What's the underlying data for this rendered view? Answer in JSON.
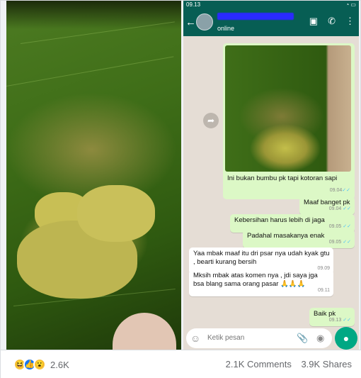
{
  "status_bar": {
    "time": "09.13",
    "right": "◔ ▭"
  },
  "chat_header": {
    "status": "online"
  },
  "image_message": {
    "caption": "Ini bukan bumbu pk tapi kotoran sapi",
    "time": "09.04"
  },
  "messages": [
    {
      "text": "Maaf banget pk",
      "time": "09.04",
      "dir": "out"
    },
    {
      "text": "Kebersihan harus lebih di jaga",
      "time": "09.05",
      "dir": "out"
    },
    {
      "text": "Padahal masakanya enak",
      "time": "09.05",
      "dir": "out"
    },
    {
      "text": "Yaa mbak maaf itu dri psar nya udah kyak gtu , bearti kurang bersih",
      "time": "09.09",
      "dir": "in"
    },
    {
      "text": "Mksih mbak atas komen nya , jdi saya jga bsa blang sama orang pasar 🙏🙏🙏",
      "time": "09.11",
      "dir": "in"
    },
    {
      "text": "Baik pk",
      "time": "09.13",
      "dir": "out"
    }
  ],
  "input": {
    "placeholder": "Ketik pesan"
  },
  "icons": {
    "back": "arrow-left-icon",
    "video": "video-call-icon",
    "phone": "phone-icon",
    "menu": "more-vertical-icon",
    "emoji": "emoji-icon",
    "attach": "paperclip-icon",
    "camera": "camera-icon",
    "mic": "mic-icon",
    "share": "forward-icon"
  },
  "colors": {
    "header": "#075e54",
    "outgoing": "#dcf8c6",
    "incoming": "#ffffff",
    "chat_bg": "#e5ddd5",
    "mic": "#00a884"
  },
  "footer": {
    "reactions": [
      "haha",
      "like",
      "wow"
    ],
    "reaction_count": "2.6K",
    "comments": "2.1K Comments",
    "shares": "3.9K Shares"
  }
}
